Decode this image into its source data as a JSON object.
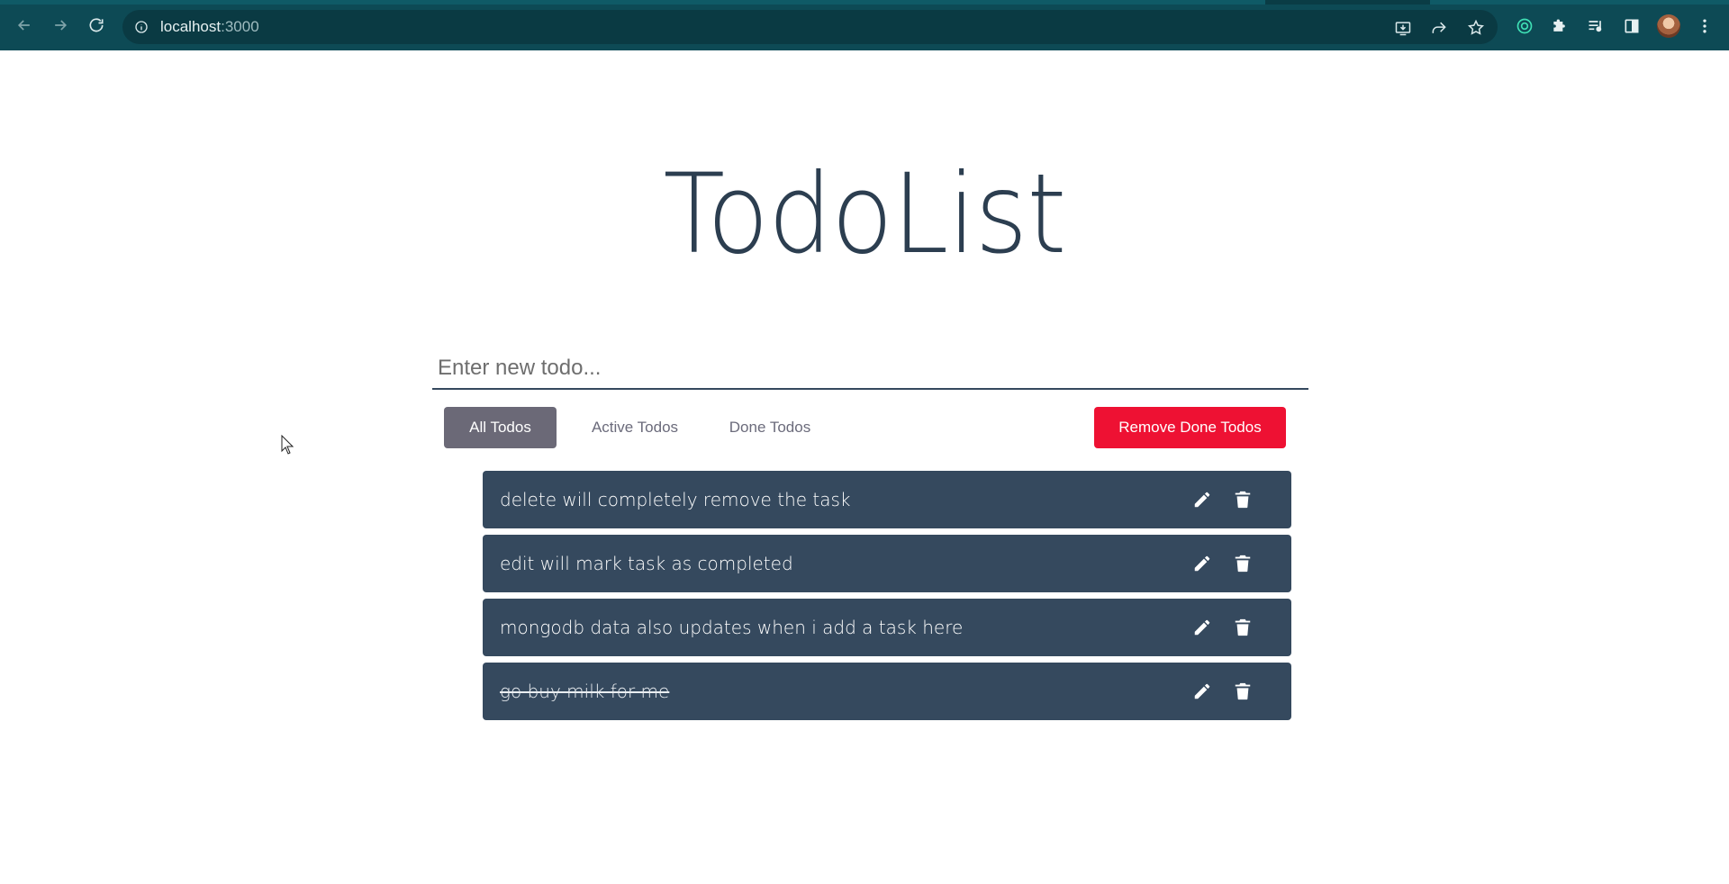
{
  "browser": {
    "url_host": "localhost",
    "url_port": ":3000",
    "icons": {
      "back": "arrow-left-icon",
      "forward": "arrow-right-icon",
      "reload": "reload-icon",
      "site_info": "info-icon",
      "install": "install-icon",
      "share": "share-icon",
      "bookmark": "star-icon",
      "extension_circle": "extension-circle-icon",
      "extensions": "puzzle-icon",
      "media": "media-queue-icon",
      "side_panel": "side-panel-icon",
      "menu": "more-vertical-icon"
    },
    "colors": {
      "toolbar": "#0d4a55",
      "omnibox": "#0a3a43"
    }
  },
  "app": {
    "title": "TodoList",
    "new_todo_placeholder": "Enter new todo...",
    "filters": [
      {
        "label": "All Todos",
        "active": true
      },
      {
        "label": "Active Todos",
        "active": false
      },
      {
        "label": "Done Todos",
        "active": false
      }
    ],
    "remove_done_label": "Remove Done Todos",
    "todos": [
      {
        "text": "delete will completely remove the task",
        "done": false
      },
      {
        "text": "edit will mark task as completed",
        "done": false
      },
      {
        "text": "mongodb data also updates when i add a task here",
        "done": false
      },
      {
        "text": "go buy milk for me",
        "done": true
      }
    ],
    "colors": {
      "title": "#2c3e50",
      "item_bg": "#35495e",
      "active_filter": "#6b6977",
      "danger": "#ee1133"
    }
  }
}
